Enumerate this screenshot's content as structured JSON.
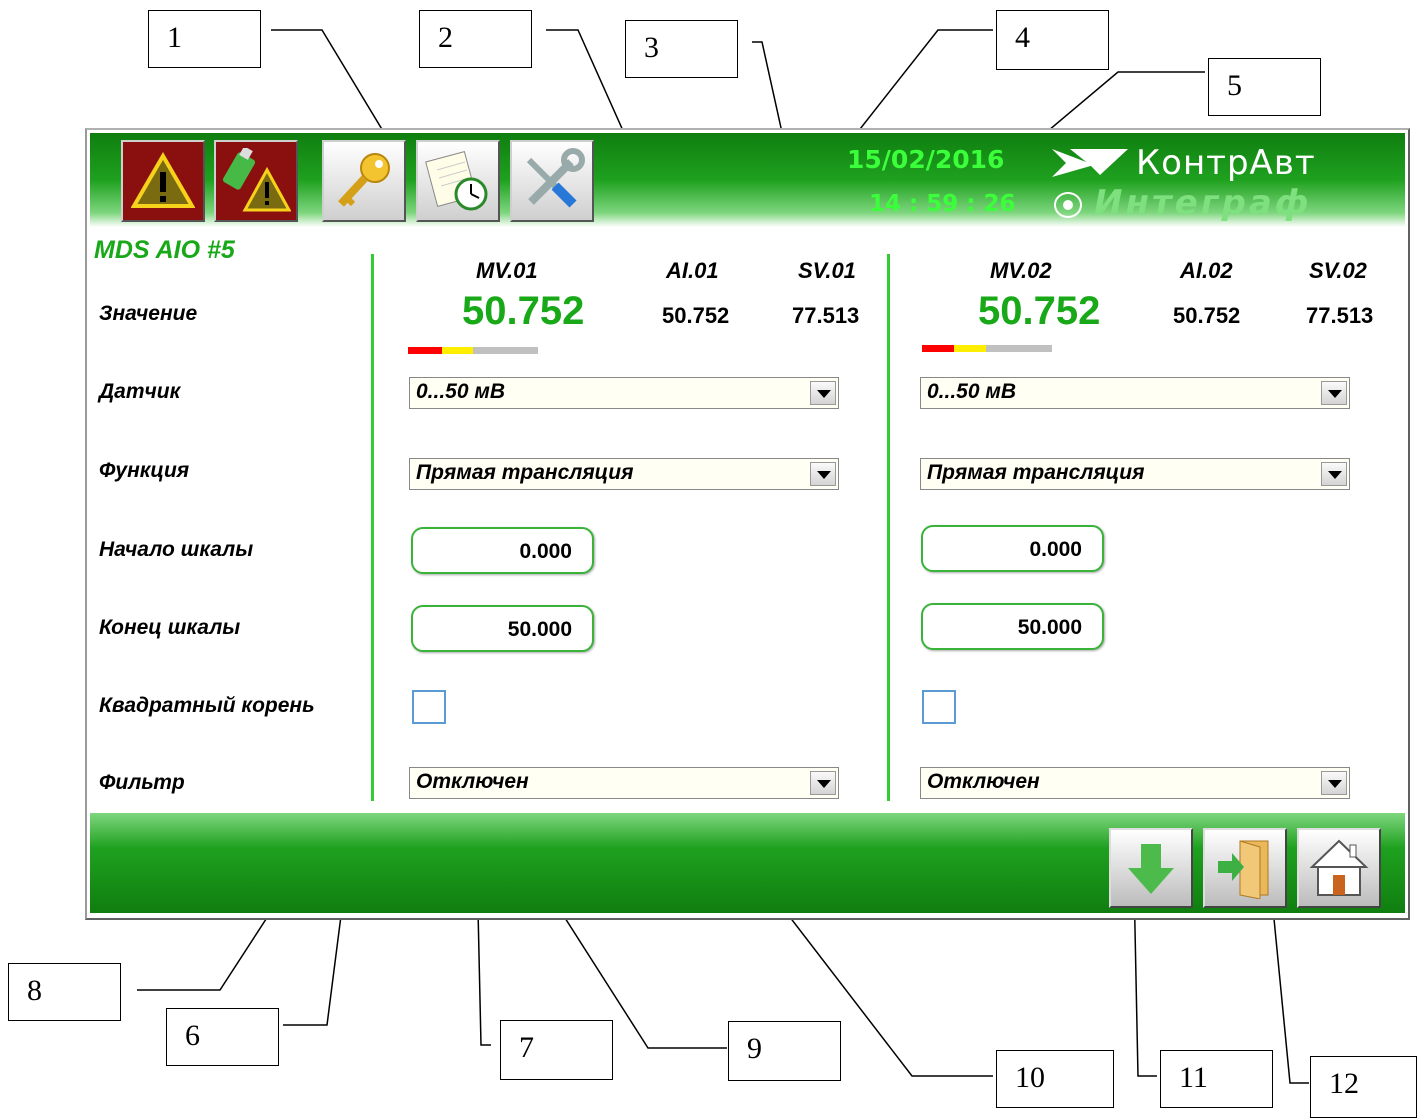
{
  "callouts": [
    "1",
    "2",
    "3",
    "4",
    "5",
    "6",
    "7",
    "8",
    "9",
    "10",
    "11",
    "12"
  ],
  "header": {
    "date": "15/02/2016",
    "time": "14 : 59 : 26",
    "brand_name": "КонтрАвт",
    "brand_product": "Интеграф",
    "toolbar_icons": [
      "alarm-icon",
      "usb-alarm-icon",
      "key-icon",
      "schedule-icon",
      "tools-icon"
    ]
  },
  "device_title": "MDS AIO #5",
  "labels": {
    "value": "Значение",
    "sensor": "Датчик",
    "function": "Функция",
    "scale_start": "Начало шкалы",
    "scale_end": "Конец шкалы",
    "sqrt": "Квадратный корень",
    "filter": "Фильтр"
  },
  "channels": [
    {
      "mv_label": "MV.01",
      "ai_label": "AI.01",
      "sv_label": "SV.01",
      "mv_value": "50.752",
      "ai_value": "50.752",
      "sv_value": "77.513",
      "sensor": "0...50 мВ",
      "function": "Прямая трансляция",
      "scale_start": "0.000",
      "scale_end": "50.000",
      "sqrt_checked": false,
      "filter": "Отключен"
    },
    {
      "mv_label": "MV.02",
      "ai_label": "AI.02",
      "sv_label": "SV.02",
      "mv_value": "50.752",
      "ai_value": "50.752",
      "sv_value": "77.513",
      "sensor": "0...50 мВ",
      "function": "Прямая трансляция",
      "scale_start": "0.000",
      "scale_end": "50.000",
      "sqrt_checked": false,
      "filter": "Отключен"
    }
  ],
  "status_bar_colors": [
    "#ff0000",
    "#ffee00",
    "#c0c0c0"
  ],
  "footer_icons": [
    "download-arrow-icon",
    "exit-door-icon",
    "home-icon"
  ],
  "colors": {
    "accent_green": "#18a818",
    "bar_green": "#1fa11f",
    "date_green": "#3bff3b"
  }
}
